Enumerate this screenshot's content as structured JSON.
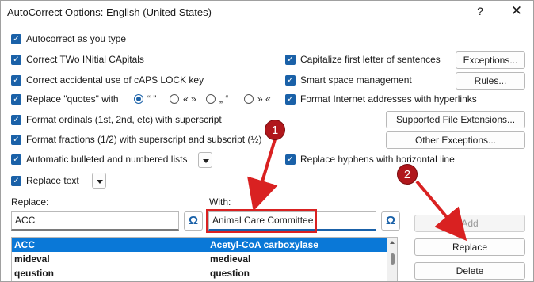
{
  "window": {
    "title": "AutoCorrect Options: English (United States)",
    "help_glyph": "?",
    "close_glyph": "✕"
  },
  "checks": {
    "autocorrect": "Autocorrect as you type",
    "two_initial": "Correct TWo INitial CApitals",
    "caps_lock": "Correct accidental use of cAPS LOCK key",
    "replace_quotes": "Replace \"quotes\" with",
    "ordinals": "Format ordinals (1st, 2nd, etc) with superscript",
    "fractions": "Format fractions (1/2) with superscript and subscript (½)",
    "bulleted": "Automatic bulleted and numbered lists",
    "replace_text": "Replace text",
    "capitalize_first": "Capitalize first letter of sentences",
    "smart_space": "Smart space management",
    "internet": "Format Internet addresses with hyperlinks",
    "hyphens": "Replace hyphens with horizontal line"
  },
  "checkbox_glyph": "✓",
  "quotes_options": [
    "“ ”",
    "« »",
    "„ “",
    "» «"
  ],
  "quotes_selected": 0,
  "buttons": {
    "exceptions": "Exceptions...",
    "rules": "Rules...",
    "supported_ext": "Supported File Extensions...",
    "other_exceptions": "Other Exceptions...",
    "add": "Add",
    "replace": "Replace",
    "delete": "Delete"
  },
  "fields": {
    "replace_label": "Replace:",
    "with_label": "With:",
    "replace_value": "ACC",
    "with_value": "Animal Care Committee",
    "omega_glyph": "Ω"
  },
  "list_rows": [
    {
      "replace": "ACC",
      "with": "Acetyl-CoA carboxylase",
      "selected": true
    },
    {
      "replace": "mideval",
      "with": "medieval",
      "selected": false
    },
    {
      "replace": "qeustion",
      "with": "question",
      "selected": false
    }
  ],
  "annotations": {
    "step1": "1",
    "step2": "2",
    "color": "#d92121"
  }
}
